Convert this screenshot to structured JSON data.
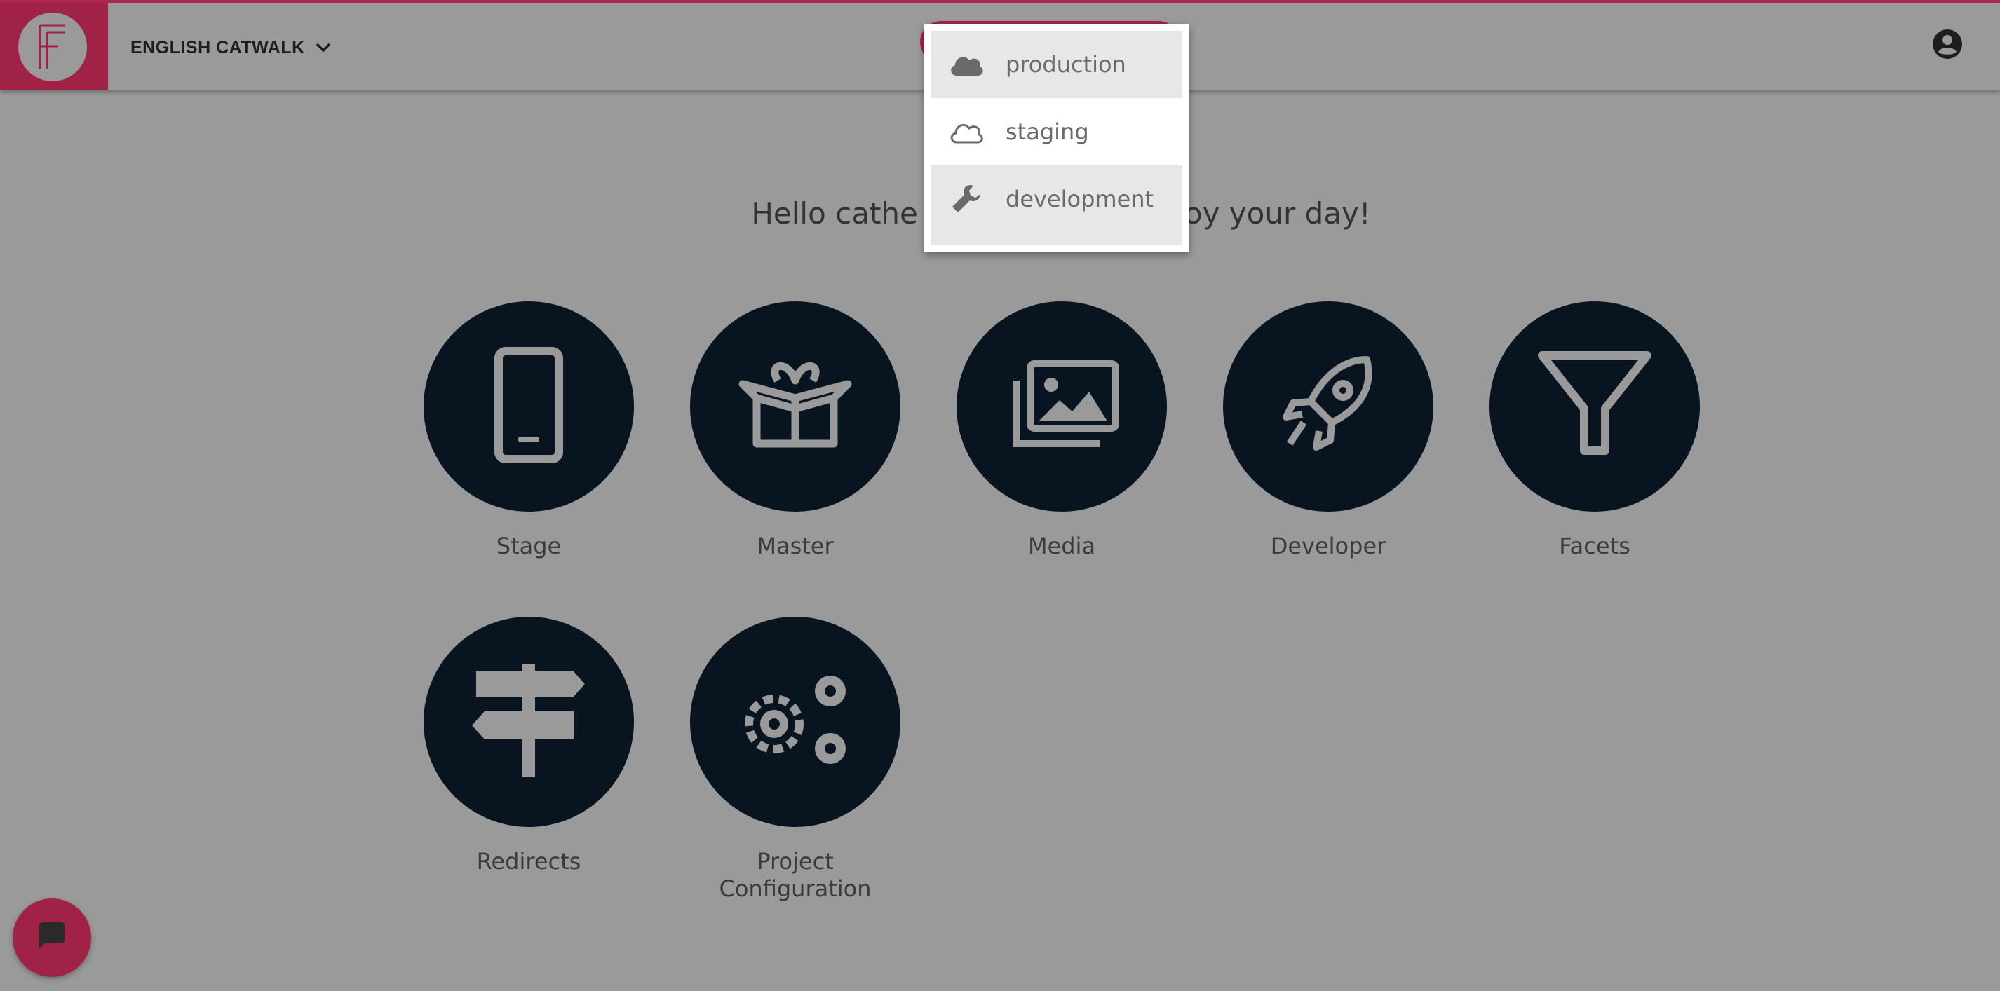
{
  "header": {
    "logo_icon": "f-logo-icon",
    "project_name": "ENGLISH CATWALK",
    "project_dropdown_icon": "chevron-down-icon",
    "user_icon": "account-circle-icon",
    "accent_color": "#a02347"
  },
  "environment_menu": {
    "items": [
      {
        "label": "production",
        "icon": "cloud-filled-icon"
      },
      {
        "label": "staging",
        "icon": "cloud-outline-icon",
        "selected": true
      },
      {
        "label": "development",
        "icon": "wrench-icon"
      }
    ]
  },
  "greeting": {
    "left": "Hello cathe",
    "right": "oy your day!"
  },
  "tiles": [
    {
      "label": "Stage",
      "icon": "smartphone-icon"
    },
    {
      "label": "Master",
      "icon": "open-box-icon"
    },
    {
      "label": "Media",
      "icon": "images-icon"
    },
    {
      "label": "Developer",
      "icon": "rocket-icon"
    },
    {
      "label": "Facets",
      "icon": "filter-icon"
    },
    {
      "label": "Redirects",
      "icon": "signpost-icon"
    },
    {
      "label": "Project\nConfiguration",
      "icon": "gears-icon"
    }
  ],
  "chat": {
    "icon": "chat-bubble-icon"
  }
}
